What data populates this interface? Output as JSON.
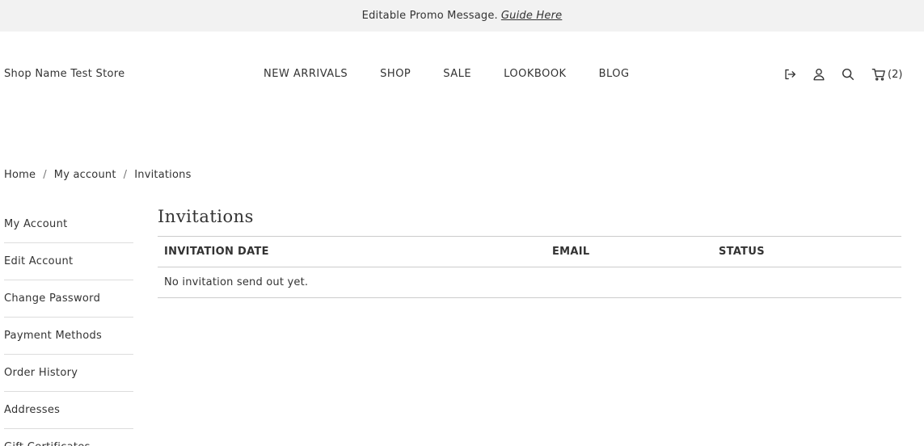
{
  "promo": {
    "message": "Editable Promo Message.",
    "link": "Guide Here"
  },
  "header": {
    "store_name": "Shop Name Test Store",
    "nav": [
      "NEW ARRIVALS",
      "SHOP",
      "SALE",
      "LOOKBOOK",
      "BLOG"
    ],
    "icons": [
      "logout-icon",
      "user-icon",
      "search-icon",
      "cart-icon"
    ],
    "cart_count": "(2)"
  },
  "breadcrumb": {
    "items": [
      "Home",
      "My account",
      "Invitations"
    ],
    "separator": "/"
  },
  "sidebar": {
    "items": [
      "My Account",
      "Edit Account",
      "Change Password",
      "Payment Methods",
      "Order History",
      "Addresses",
      "Gift Certificates"
    ]
  },
  "content": {
    "title": "Invitations",
    "columns": [
      "INVITATION DATE",
      "EMAIL",
      "STATUS"
    ],
    "empty_message": "No invitation send out yet."
  }
}
